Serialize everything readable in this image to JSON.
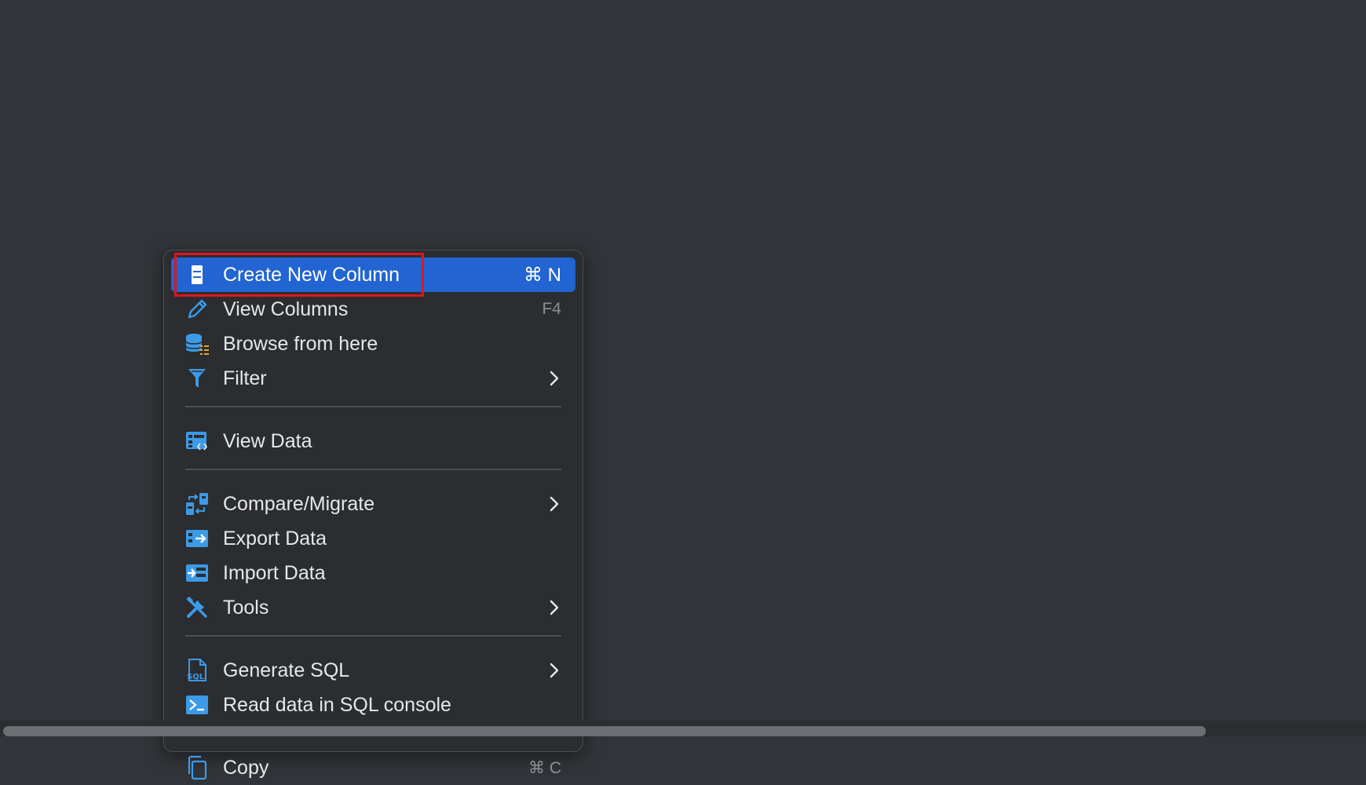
{
  "menu": {
    "items": [
      {
        "label": "Create New Column",
        "shortcut": "⌘ N",
        "icon": "column-icon",
        "selected": true
      },
      {
        "label": "View Columns",
        "shortcut": "F4",
        "icon": "pencil-icon"
      },
      {
        "label": "Browse from here",
        "icon": "database-browse-icon"
      },
      {
        "label": "Filter",
        "icon": "filter-icon",
        "submenu": true
      },
      {
        "label": "View Data",
        "icon": "table-view-icon"
      },
      {
        "label": "Compare/Migrate",
        "icon": "compare-icon",
        "submenu": true
      },
      {
        "label": "Export Data",
        "icon": "export-icon"
      },
      {
        "label": "Import Data",
        "icon": "import-icon"
      },
      {
        "label": "Tools",
        "icon": "tools-icon",
        "submenu": true
      },
      {
        "label": "Generate SQL",
        "icon": "sql-file-icon",
        "submenu": true
      },
      {
        "label": "Read data in SQL console",
        "icon": "console-icon"
      },
      {
        "label": "Copy",
        "shortcut": "⌘ C",
        "icon": "copy-icon"
      }
    ]
  },
  "colors": {
    "background": "#313438",
    "menu_background": "#2b2d30",
    "selection": "#2264d1",
    "icon_blue": "#3c9ae8",
    "highlight_box": "#e3141c"
  }
}
